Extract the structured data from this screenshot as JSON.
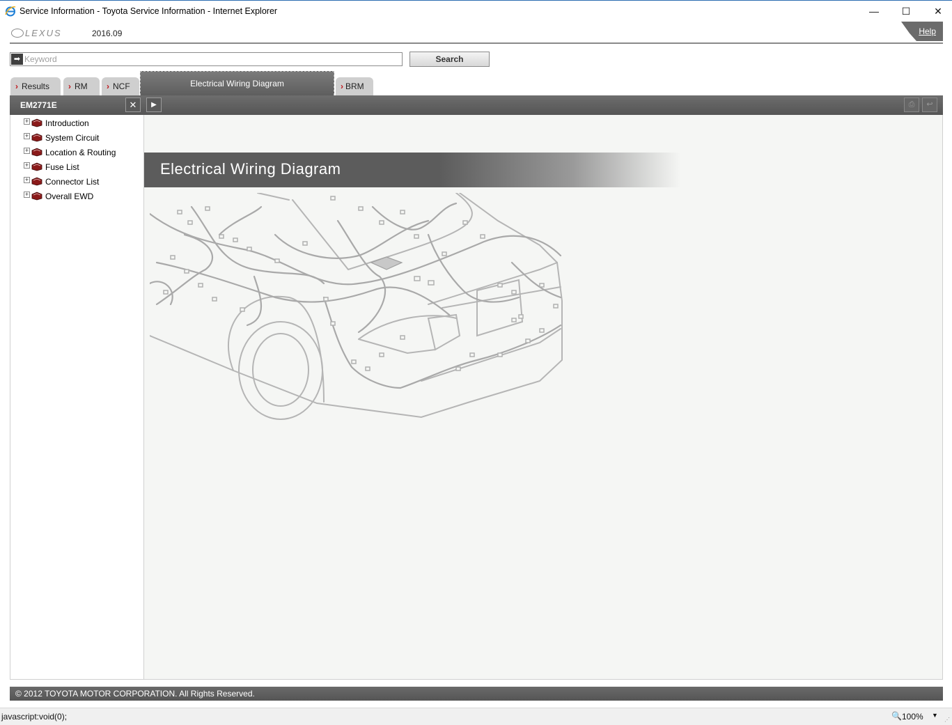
{
  "window": {
    "title": "Service Information - Toyota Service Information - Internet Explorer",
    "min_glyph": "—",
    "max_glyph": "☐",
    "close_glyph": "✕"
  },
  "header": {
    "logo_text": "LEXUS",
    "version": "2016.09",
    "help_label": "Help"
  },
  "search": {
    "placeholder": "Keyword",
    "value": "",
    "button_label": "Search",
    "arrow_glyph": "➡"
  },
  "tabs": [
    {
      "label": "Results",
      "active": false
    },
    {
      "label": "RM",
      "active": false
    },
    {
      "label": "NCF",
      "active": false
    },
    {
      "label": "Electrical Wiring Diagram",
      "active": true
    },
    {
      "label": "BRM",
      "active": false
    }
  ],
  "toolbar": {
    "doc_id": "EM2771E",
    "close_glyph": "✕",
    "expand_glyph": "▶",
    "print_glyph": "⎙",
    "back_glyph": "↩"
  },
  "tree": {
    "expand_glyph": "+",
    "items": [
      {
        "label": "Introduction"
      },
      {
        "label": "System Circuit"
      },
      {
        "label": "Location & Routing"
      },
      {
        "label": "Fuse List"
      },
      {
        "label": "Connector List"
      },
      {
        "label": "Overall EWD"
      }
    ]
  },
  "main": {
    "banner_title": "Electrical Wiring Diagram"
  },
  "footer": {
    "copyright": "© 2012 TOYOTA MOTOR CORPORATION. All Rights Reserved."
  },
  "status": {
    "text": "javascript:void(0);",
    "zoom": "100%",
    "zoom_glyph": "🔍",
    "dropdown_glyph": "▼"
  },
  "colors": {
    "accent_chevron": "#c0151b",
    "bar_gray": "#5e5e5e",
    "book_red": "#8b1a1a"
  }
}
